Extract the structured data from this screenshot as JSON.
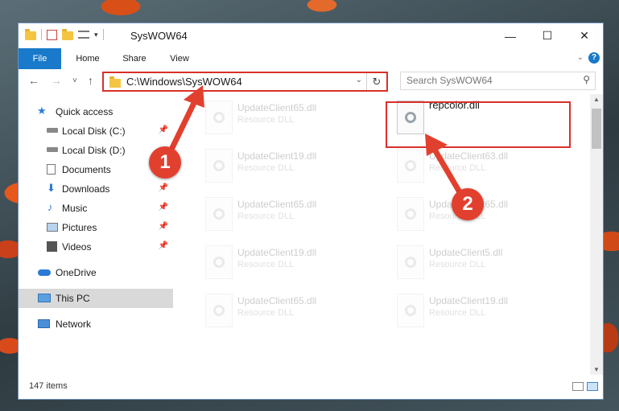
{
  "window": {
    "title": "SysWOW64",
    "minimize": "—",
    "maximize": "☐",
    "close": "✕"
  },
  "ribbon": {
    "tabs": [
      "File",
      "Home",
      "Share",
      "View"
    ],
    "help": "?"
  },
  "nav": {
    "back": "←",
    "forward": "→",
    "recent": "˅",
    "up": "↑",
    "address": "C:\\Windows\\SysWOW64",
    "address_dropdown": "⌄",
    "refresh": "↻",
    "search_placeholder": "Search SysWOW64"
  },
  "sidebar": {
    "items": [
      {
        "label": "Quick access",
        "icon": "star-icon",
        "pinned": false
      },
      {
        "label": "Local Disk (C:)",
        "icon": "drive-icon",
        "pinned": true
      },
      {
        "label": "Local Disk (D:)",
        "icon": "drive-icon",
        "pinned": false
      },
      {
        "label": "Documents",
        "icon": "documents-icon",
        "pinned": true
      },
      {
        "label": "Downloads",
        "icon": "download-icon",
        "pinned": true
      },
      {
        "label": "Music",
        "icon": "music-icon",
        "pinned": true
      },
      {
        "label": "Pictures",
        "icon": "pictures-icon",
        "pinned": true
      },
      {
        "label": "Videos",
        "icon": "videos-icon",
        "pinned": true
      },
      {
        "label": "OneDrive",
        "icon": "onedrive-icon",
        "pinned": false
      },
      {
        "label": "This PC",
        "icon": "pc-icon",
        "pinned": false,
        "selected": true
      },
      {
        "label": "Network",
        "icon": "network-icon",
        "pinned": false
      }
    ]
  },
  "files": [
    {
      "name": "UpdateClient65.dll",
      "type": "Resource DLL"
    },
    {
      "name": "repcolor.dll",
      "type": ""
    },
    {
      "name": "UpdateClient19.dll",
      "type": "Resource DLL"
    },
    {
      "name": "UpdateClient63.dll",
      "type": "Resource DLL"
    },
    {
      "name": "UpdateClient65.dll",
      "type": "Resource DLL"
    },
    {
      "name": "UpdateClient65.dll",
      "type": "Resource DLL"
    },
    {
      "name": "UpdateClient19.dll",
      "type": "Resource DLL"
    },
    {
      "name": "UpdateClient5.dll",
      "type": "Resource DLL"
    },
    {
      "name": "UpdateClient65.dll",
      "type": "Resource DLL"
    },
    {
      "name": "UpdateClient19.dll",
      "type": "Resource DLL"
    }
  ],
  "status": {
    "item_count": "147 items"
  },
  "annotations": {
    "step1": "1",
    "step2": "2",
    "color": "#e2402f"
  }
}
